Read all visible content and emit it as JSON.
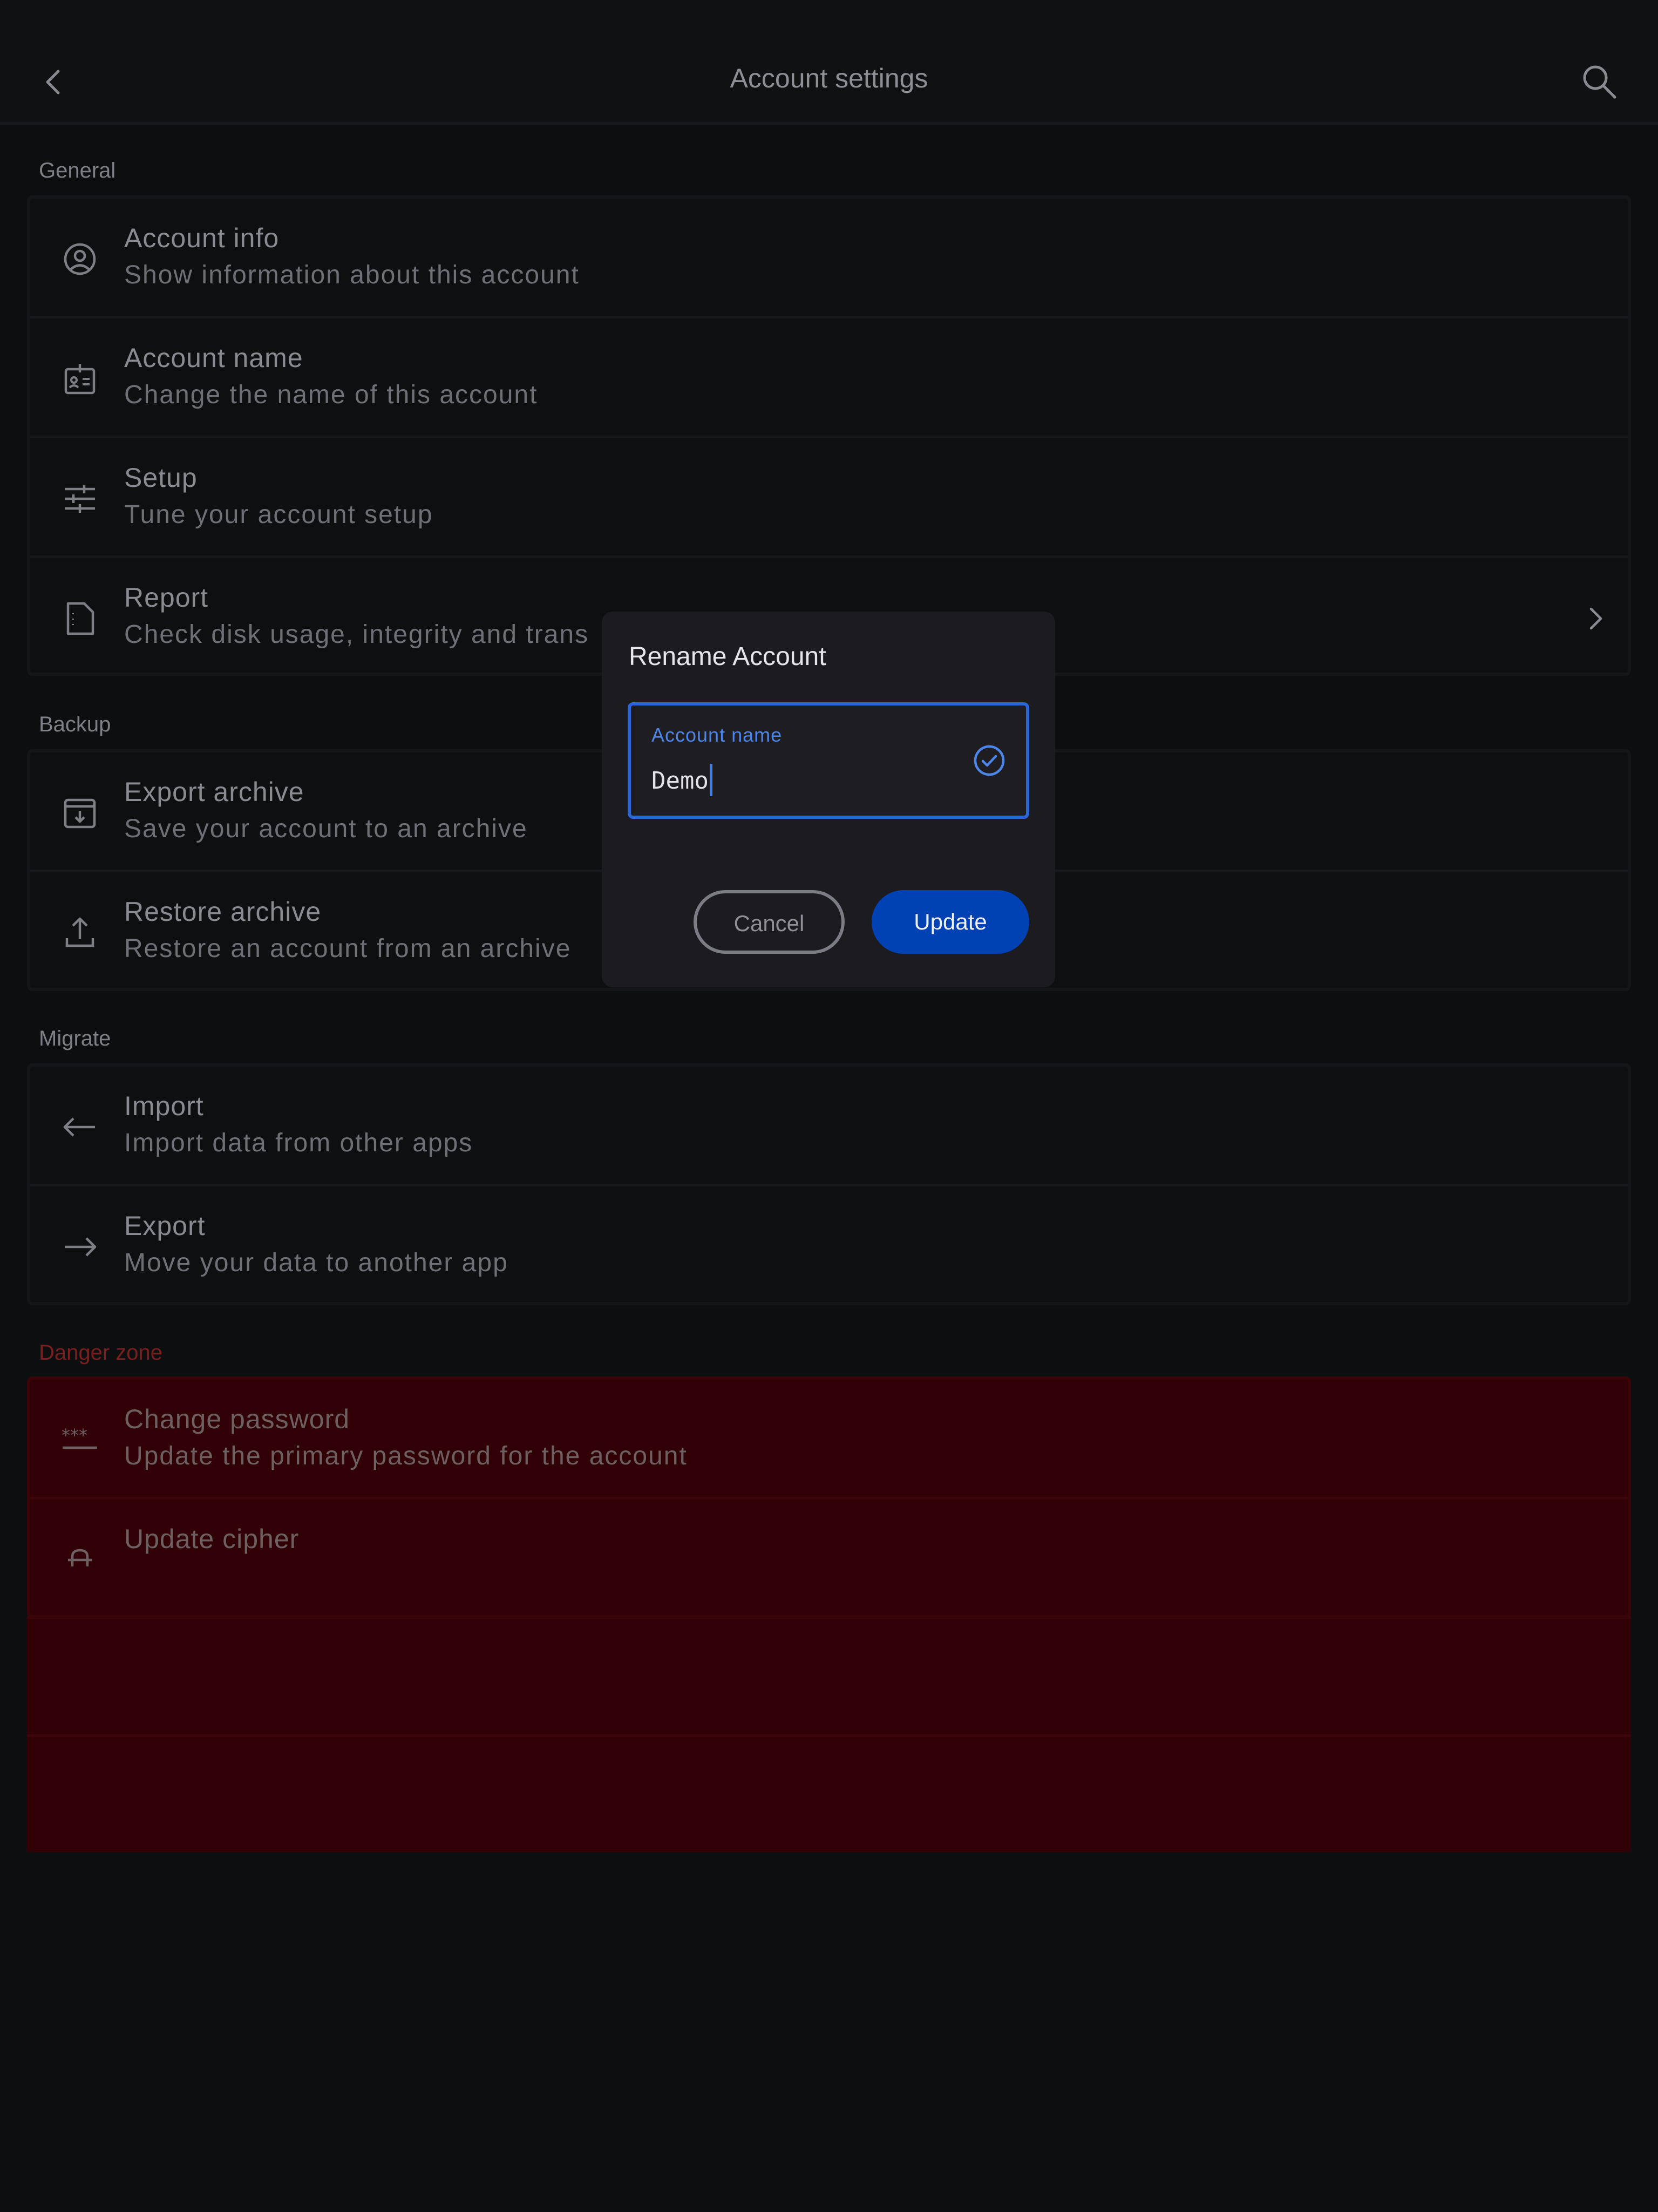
{
  "header": {
    "title": "Account settings"
  },
  "sections": [
    {
      "label": "General",
      "items": [
        {
          "title": "Account info",
          "subtitle": "Show information about this account"
        },
        {
          "title": "Account name",
          "subtitle": "Change the name of this account"
        },
        {
          "title": "Setup",
          "subtitle": "Tune your account setup"
        },
        {
          "title": "Report",
          "subtitle": "Check disk usage, integrity and trans"
        }
      ]
    },
    {
      "label": "Backup",
      "items": [
        {
          "title": "Export archive",
          "subtitle": "Save your account to an archive"
        },
        {
          "title": "Restore archive",
          "subtitle": "Restore an account from an archive"
        }
      ]
    },
    {
      "label": "Migrate",
      "items": [
        {
          "title": "Import",
          "subtitle": "Import data from other apps"
        },
        {
          "title": "Export",
          "subtitle": "Move your data to another app"
        }
      ]
    },
    {
      "label": "Danger zone",
      "items": [
        {
          "title": "Change password",
          "subtitle": "Update the primary password for the account"
        },
        {
          "title": "Update cipher",
          "subtitle": ""
        }
      ]
    }
  ],
  "dialog": {
    "title": "Rename Account",
    "field_label": "Account name",
    "field_value": "Demo",
    "cancel_label": "Cancel",
    "update_label": "Update"
  },
  "colors": {
    "accent": "#2a66d4",
    "primary_button": "#0041b3",
    "danger_bg": "#300006",
    "danger_text": "#7a1f1f"
  }
}
